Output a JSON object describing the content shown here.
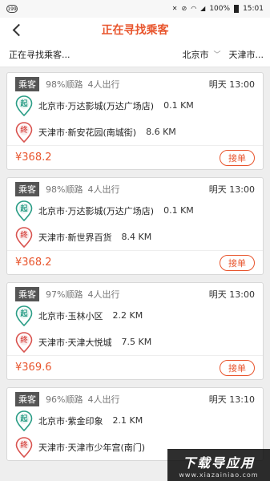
{
  "status_bar": {
    "notification_badge": "199",
    "icons": [
      "mute-icon",
      "no-sim-icon",
      "wifi-icon",
      "signal-icon"
    ],
    "battery": "100%",
    "time": "15:01"
  },
  "header": {
    "title": "正在寻找乘客",
    "back_icon": "chevron-left-icon"
  },
  "filter": {
    "status": "正在寻找乘客...",
    "from_city": "北京市",
    "to_city": "天津市..."
  },
  "colors": {
    "accent": "#e8552d",
    "start_pin": "#2a9d86",
    "end_pin": "#d9534f",
    "tag_bg": "#555555"
  },
  "orders": [
    {
      "tag": "乘客",
      "match": "98%顺路",
      "passengers": "4人出行",
      "time": "明天 13:00",
      "start_label": "起",
      "start_place": "北京市·万达影城(万达广场店)",
      "start_dist": "0.1 KM",
      "end_label": "终",
      "end_place": "天津市·新安花园(南城街)",
      "end_dist": "8.6 KM",
      "price": "¥368.2",
      "button": "接单"
    },
    {
      "tag": "乘客",
      "match": "98%顺路",
      "passengers": "4人出行",
      "time": "明天 13:00",
      "start_label": "起",
      "start_place": "北京市·万达影城(万达广场店)",
      "start_dist": "0.1 KM",
      "end_label": "终",
      "end_place": "天津市·新世界百货",
      "end_dist": "8.4 KM",
      "price": "¥368.2",
      "button": "接单"
    },
    {
      "tag": "乘客",
      "match": "97%顺路",
      "passengers": "4人出行",
      "time": "明天 13:00",
      "start_label": "起",
      "start_place": "北京市·玉林小区",
      "start_dist": "2.2 KM",
      "end_label": "终",
      "end_place": "天津市·天津大悦城",
      "end_dist": "7.5 KM",
      "price": "¥369.6",
      "button": "接单"
    },
    {
      "tag": "乘客",
      "match": "96%顺路",
      "passengers": "4人出行",
      "time": "明天 13:10",
      "start_label": "起",
      "start_place": "北京市·紫金印象",
      "start_dist": "2.1 KM",
      "end_label": "终",
      "end_place": "天津市·天津市少年宫(南门)",
      "end_dist": "",
      "price": "",
      "button": ""
    }
  ],
  "watermark": {
    "main": "下载导应用",
    "url": "www.xiazainiao.com"
  }
}
